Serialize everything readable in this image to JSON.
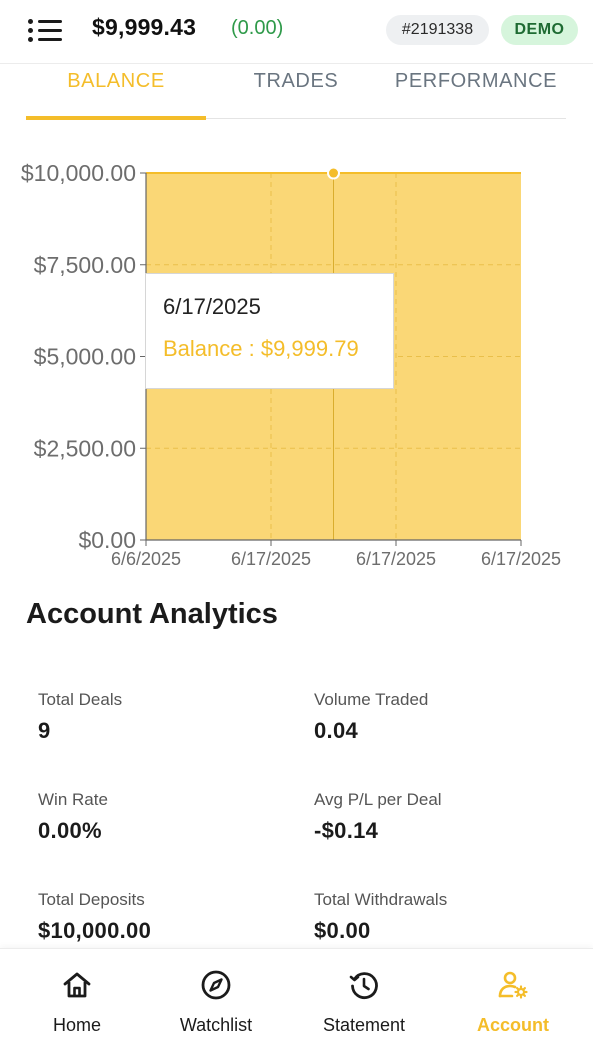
{
  "header": {
    "balance": "$9,999.43",
    "balance_change": "(0.00)",
    "account_id": "#2191338",
    "mode_badge": "DEMO"
  },
  "tabs": [
    {
      "label": "BALANCE",
      "active": true
    },
    {
      "label": "TRADES",
      "active": false
    },
    {
      "label": "PERFORMANCE",
      "active": false
    }
  ],
  "chart_data": {
    "type": "area",
    "x_tick_labels": [
      "6/6/2025",
      "6/17/2025",
      "6/17/2025",
      "6/17/2025"
    ],
    "y_tick_labels": [
      "$0.00",
      "$2,500.00",
      "$5,000.00",
      "$7,500.00",
      "$10,000.00"
    ],
    "ylim": [
      0,
      10000
    ],
    "x": [
      0,
      1,
      2,
      3
    ],
    "series": [
      {
        "values": [
          10000,
          10000,
          9999.79,
          9999.79
        ],
        "color": "#fad776",
        "stroke": "#f4bd2a"
      }
    ],
    "grid": true,
    "highlight_index": 2,
    "tooltip": {
      "date": "6/17/2025",
      "text": "Balance : $9,999.79"
    }
  },
  "analytics": {
    "title": "Account Analytics",
    "stats": [
      {
        "label": "Total Deals",
        "value": "9"
      },
      {
        "label": "Volume Traded",
        "value": "0.04"
      },
      {
        "label": "Win Rate",
        "value": "0.00%"
      },
      {
        "label": "Avg P/L per Deal",
        "value": "-$0.14"
      },
      {
        "label": "Total Deposits",
        "value": "$10,000.00"
      },
      {
        "label": "Total Withdrawals",
        "value": "$0.00"
      }
    ]
  },
  "bottom_nav": [
    {
      "label": "Home",
      "icon": "home-icon",
      "active": false
    },
    {
      "label": "Watchlist",
      "icon": "compass-icon",
      "active": false
    },
    {
      "label": "Statement",
      "icon": "history-icon",
      "active": false
    },
    {
      "label": "Account",
      "icon": "account-settings-icon",
      "active": true
    }
  ],
  "colors": {
    "accent": "#f4bd2a",
    "chart_fill": "#fad776",
    "positive": "#2f9a4a",
    "demo_bg": "#d6f5dc",
    "demo_text": "#1e6b32"
  }
}
